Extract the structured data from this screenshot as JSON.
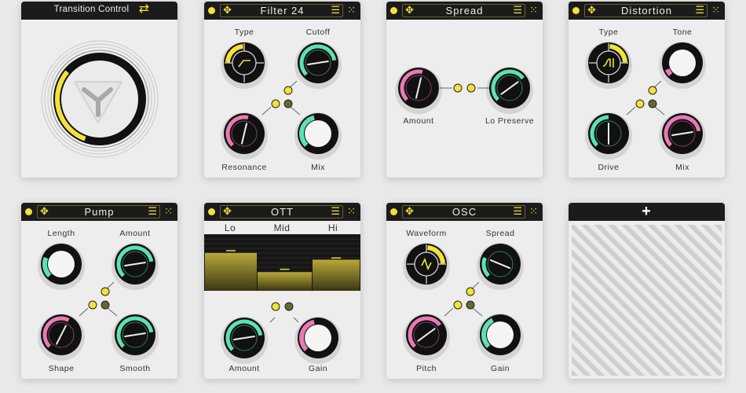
{
  "colors": {
    "accent": "#f2e23a",
    "green": "#5fe0b0",
    "pink": "#e77ab3",
    "dark": "#1b1b1b",
    "dot_dim": "#6b6630"
  },
  "transition": {
    "title": "Transition Control",
    "icon": "swap-arrows-icon",
    "value": 0.4
  },
  "panels": [
    {
      "id": "filter",
      "title": "Filter 24",
      "knobs": [
        {
          "label": "Type",
          "style": "selector",
          "color": "#f2e23a",
          "segment": "top-left",
          "icon": "lowpass-curve-icon"
        },
        {
          "label": "Cutoff",
          "style": "dial",
          "color": "#5fe0b0",
          "value": 0.8
        },
        {
          "label": "Resonance",
          "style": "dial",
          "color": "#e77ab3",
          "value": 0.55
        },
        {
          "label": "Mix",
          "style": "ring",
          "color": "#5fe0b0",
          "value": 0.45
        }
      ]
    },
    {
      "id": "spread",
      "title": "Spread",
      "knobs": [
        {
          "label": "Amount",
          "style": "dial",
          "color": "#e77ab3",
          "value": 0.55
        },
        {
          "label": "Lo Preserve",
          "style": "dial",
          "color": "#5fe0b0",
          "value": 0.7
        }
      ]
    },
    {
      "id": "distortion",
      "title": "Distortion",
      "knobs": [
        {
          "label": "Type",
          "style": "selector",
          "color": "#f2e23a",
          "segment": "top-right",
          "icon": "saturation-curve-icon"
        },
        {
          "label": "Tone",
          "style": "ring",
          "color": "#e77ab3",
          "value": 0.08
        },
        {
          "label": "Drive",
          "style": "dial",
          "color": "#5fe0b0",
          "value": 0.5
        },
        {
          "label": "Mix",
          "style": "dial",
          "color": "#e77ab3",
          "value": 0.8
        }
      ]
    },
    {
      "id": "pump",
      "title": "Pump",
      "knobs": [
        {
          "label": "Length",
          "style": "ring",
          "color": "#5fe0b0",
          "value": 0.25
        },
        {
          "label": "Amount",
          "style": "dial",
          "color": "#5fe0b0",
          "value": 0.8
        },
        {
          "label": "Shape",
          "style": "dial",
          "color": "#e77ab3",
          "value": 0.6
        },
        {
          "label": "Smooth",
          "style": "dial",
          "color": "#5fe0b0",
          "value": 0.8
        }
      ]
    },
    {
      "id": "ott",
      "title": "OTT",
      "bands": [
        {
          "label": "Lo",
          "level": 0.67,
          "peak": 0.71
        },
        {
          "label": "Mid",
          "level": 0.33,
          "peak": 0.38
        },
        {
          "label": "Hi",
          "level": 0.55,
          "peak": 0.58
        }
      ],
      "knobs": [
        {
          "label": "Amount",
          "style": "dial",
          "color": "#5fe0b0",
          "value": 0.8
        },
        {
          "label": "Gain",
          "style": "ring",
          "color": "#e77ab3",
          "value": 0.45
        }
      ]
    },
    {
      "id": "osc",
      "title": "OSC",
      "knobs": [
        {
          "label": "Waveform",
          "style": "selector",
          "color": "#f2e23a",
          "segment": "top-right",
          "icon": "saw-wave-icon"
        },
        {
          "label": "Spread",
          "style": "dial",
          "color": "#5fe0b0",
          "value": 0.25
        },
        {
          "label": "Pitch",
          "style": "dial",
          "color": "#e77ab3",
          "value": 0.7
        },
        {
          "label": "Gain",
          "style": "ring",
          "color": "#5fe0b0",
          "value": 0.4
        }
      ]
    }
  ],
  "empty_slot": {
    "icon": "plus-icon",
    "label": "+"
  }
}
